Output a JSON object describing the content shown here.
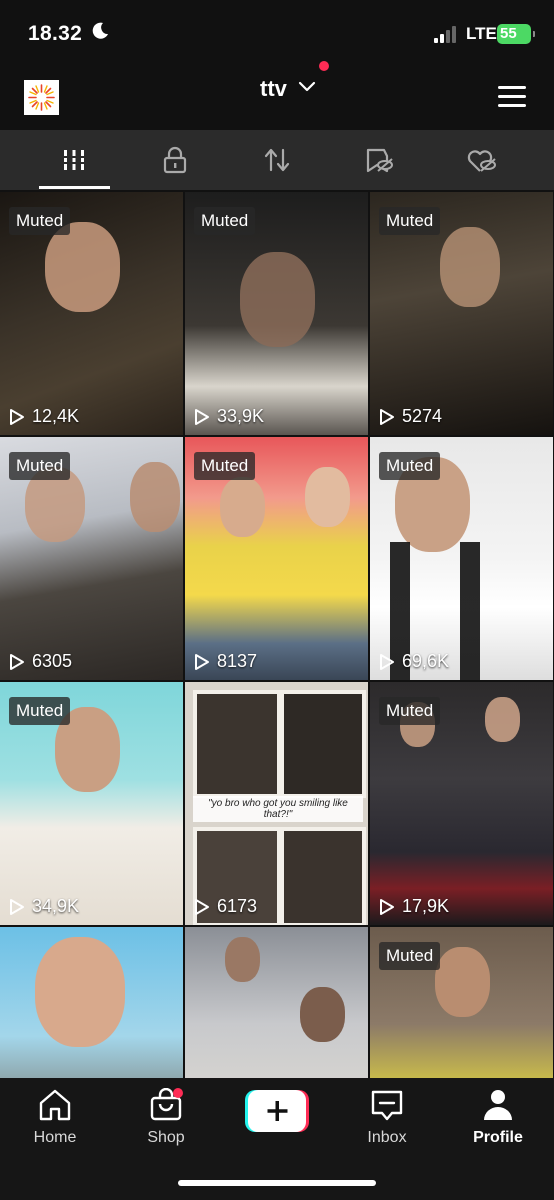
{
  "status_bar": {
    "time": "18.32",
    "network": "LTE",
    "battery": "55"
  },
  "header": {
    "account": "ttv"
  },
  "tabs": [
    {
      "name": "tab-videos",
      "icon": "grid-icon",
      "active": true
    },
    {
      "name": "tab-private",
      "icon": "lock-icon"
    },
    {
      "name": "tab-reposts",
      "icon": "repost-icon"
    },
    {
      "name": "tab-favorites",
      "icon": "bookmark-hidden-icon"
    },
    {
      "name": "tab-liked",
      "icon": "heart-hidden-icon"
    }
  ],
  "videos": [
    {
      "muted": "Muted",
      "views": "12,4K"
    },
    {
      "muted": "Muted",
      "views": "33,9K"
    },
    {
      "muted": "Muted",
      "views": "5274"
    },
    {
      "muted": "Muted",
      "views": "6305"
    },
    {
      "muted": "Muted",
      "views": "8137"
    },
    {
      "muted": "Muted",
      "views": "69,6K"
    },
    {
      "muted": "Muted",
      "views": "34,9K"
    },
    {
      "muted": "",
      "views": "6173",
      "caption": "\"yo bro who got you smiling like that?!\""
    },
    {
      "muted": "Muted",
      "views": "17,9K"
    },
    {
      "muted": "",
      "views": ""
    },
    {
      "muted": "",
      "views": ""
    },
    {
      "muted": "Muted",
      "views": ""
    }
  ],
  "bottom_nav": {
    "home": "Home",
    "shop": "Shop",
    "inbox": "Inbox",
    "profile": "Profile"
  },
  "colors": {
    "accent": "#fe2c55",
    "battery": "#4cd964",
    "cyan": "#25f4ee"
  }
}
